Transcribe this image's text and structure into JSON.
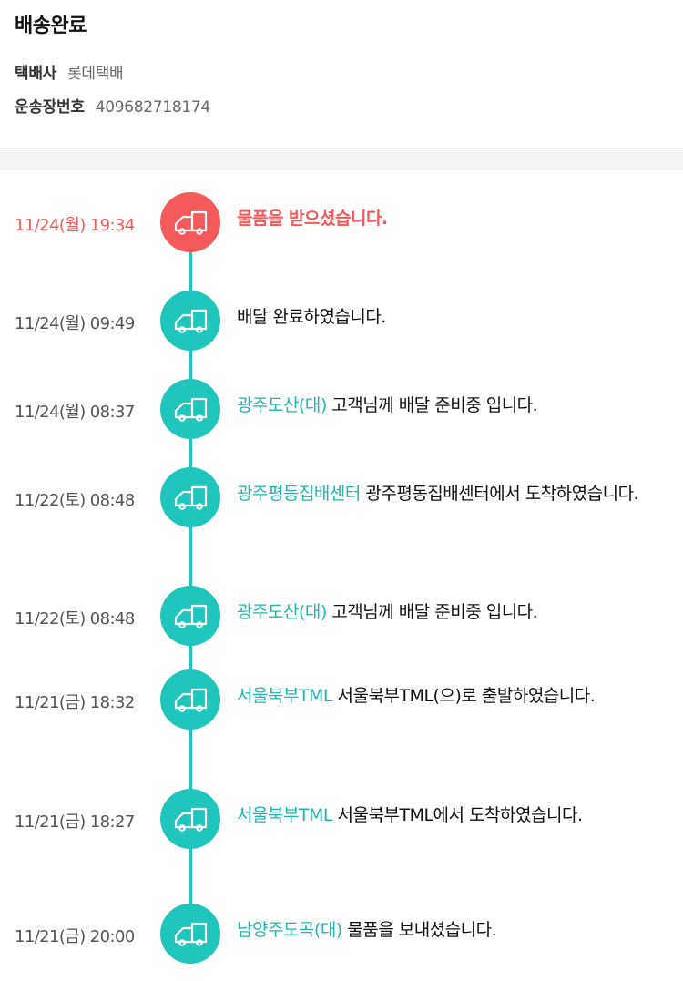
{
  "header": {
    "status_title": "배송완료",
    "carrier_label": "택배사",
    "carrier_value": "롯데택배",
    "tracking_label": "운송장번호",
    "tracking_value": "409682718174"
  },
  "colors": {
    "accent_teal": "#20c6be",
    "latest_red": "#f45a5a"
  },
  "events": [
    {
      "time": "11/24(월) 19:34",
      "location": "",
      "message": "물품을 받으셨습니다."
    },
    {
      "time": "11/24(월) 09:49",
      "location": "",
      "message": "배달 완료하였습니다."
    },
    {
      "time": "11/24(월) 08:37",
      "location": "광주도산(대)",
      "message": " 고객님께 배달 준비중 입니다."
    },
    {
      "time": "11/22(토) 08:48",
      "location": "광주평동집배센터",
      "message": " 광주평동집배센터에서 도착하였습니다."
    },
    {
      "time": "11/22(토) 08:48",
      "location": "광주도산(대)",
      "message": " 고객님께 배달 준비중 입니다."
    },
    {
      "time": "11/21(금) 18:32",
      "location": "서울북부TML",
      "message": " 서울북부TML(으)로 출발하였습니다."
    },
    {
      "time": "11/21(금) 18:27",
      "location": "서울북부TML",
      "message": " 서울북부TML에서 도착하였습니다."
    },
    {
      "time": "11/21(금) 20:00",
      "location": "남양주도곡(대)",
      "message": " 물품을 보내셨습니다."
    }
  ],
  "icons": {
    "event_icon": "truck-icon"
  }
}
